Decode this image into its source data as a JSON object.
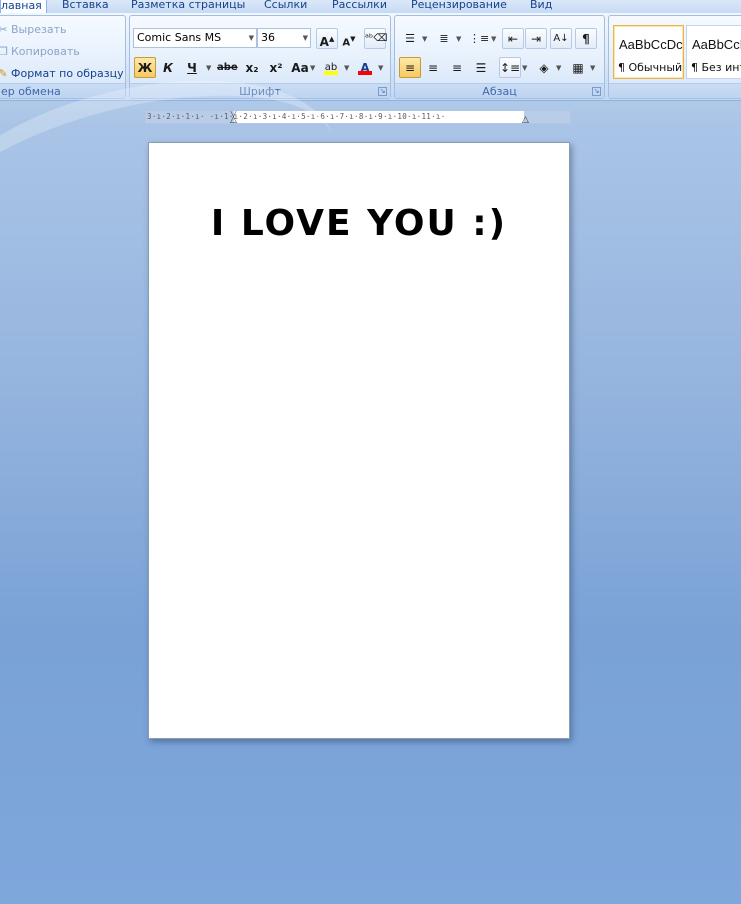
{
  "tabs": [
    "лавная",
    "Вставка",
    "Разметка страницы",
    "Ссылки",
    "Рассылки",
    "Рецензирование",
    "Вид"
  ],
  "clipboard": {
    "cut": "Вырезать",
    "copy": "Копировать",
    "format_painter": "Формат по образцу",
    "label": "ер обмена"
  },
  "font": {
    "name": "Comic Sans MS",
    "size": "36",
    "label": "Шрифт",
    "grow": "A",
    "shrink": "A",
    "bold": "Ж",
    "italic": "К",
    "underline": "Ч",
    "strike": "abe",
    "subscript": "x₂",
    "superscript": "x²",
    "change_case": "Aa",
    "highlight": "ab",
    "color": "A",
    "highlight_color": "#ffff00",
    "font_color": "#ff0000"
  },
  "paragraph": {
    "label": "Абзац",
    "show_marks": "¶"
  },
  "styles": [
    {
      "sample": "AaBbCcDc",
      "name": "¶ Обычный",
      "selected": true
    },
    {
      "sample": "AaBbCcDc",
      "name": "¶ Без инте",
      "selected": false
    }
  ],
  "ruler": {
    "marks": "3·ı·2·ı·1·ı·   ·ı·1·ı·2·ı·3·ı·4·ı·5·ı·6·ı·7·ı·8·ı·9·ı·10·ı·11·ı·"
  },
  "document": {
    "text": "I LOVE YOU :)"
  }
}
